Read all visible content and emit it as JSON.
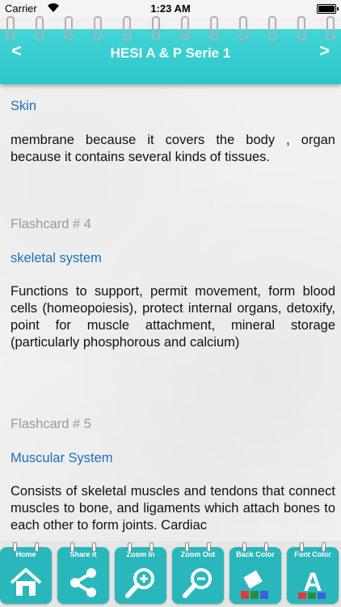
{
  "status_bar": {
    "carrier": "Carrier",
    "time": "1:23 AM"
  },
  "header": {
    "title": "HESI A & P Serie 1",
    "prev": "<",
    "next": ">"
  },
  "cards": [
    {
      "term": "Skin",
      "definition": "membrane because it covers the body , organ because it contains several kinds of tissues."
    },
    {
      "label": "Flashcard # 4",
      "term": "skeletal system",
      "definition": "Functions to support, permit movement, form blood cells (homeopoiesis), protect internal organs, detoxify, point for muscle attachment, mineral storage (particularly phosphorous and calcium)"
    },
    {
      "label": "Flashcard # 5",
      "term": "Muscular System",
      "definition": "Consists of skeletal muscles and tendons that connect muscles to bone, and ligaments which attach bones to each other to form joints. Cardiac"
    }
  ],
  "toolbar": {
    "home": "Home",
    "share": "Share it",
    "zoom_in": "Zoom In",
    "zoom_out": "Zoom Out",
    "back_color": "Back Color",
    "font_color": "Font Color",
    "font_letter": "A"
  },
  "colors": {
    "accent": "#2bc6c9",
    "term": "#1f6fb6",
    "label": "#9a9a9a"
  }
}
